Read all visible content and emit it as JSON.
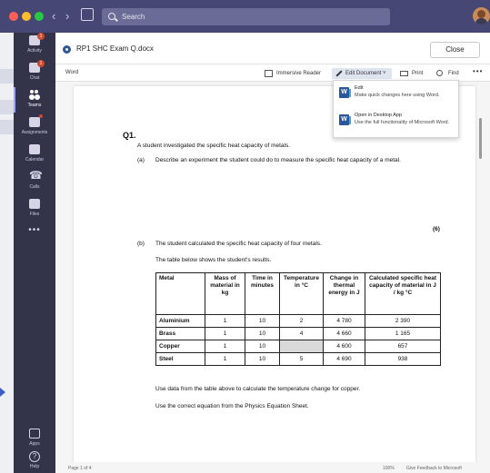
{
  "titlebar": {
    "search_placeholder": "Search",
    "back_icon": "chevron-left-icon",
    "forward_icon": "chevron-right-icon",
    "compose_icon": "compose-icon"
  },
  "rail": {
    "items": [
      {
        "label": "Activity",
        "badge": "1"
      },
      {
        "label": "Chat",
        "badge": "1"
      },
      {
        "label": "Teams"
      },
      {
        "label": "Assignments"
      },
      {
        "label": "Calendar"
      },
      {
        "label": "Calls"
      },
      {
        "label": "Files"
      }
    ],
    "more": "•••",
    "apps_label": "Apps",
    "help_label": "Help",
    "accent": "#9ea2ff"
  },
  "file": {
    "name": "RP1 SHC Exam Q.docx",
    "close_label": "Close"
  },
  "ribbon": {
    "app_label": "Word",
    "immersive_reader": "Immersive Reader",
    "edit_document": "Edit Document ˅",
    "print": "Print",
    "find": "Find",
    "more": "•••"
  },
  "dropdown": {
    "items": [
      {
        "icon": "W",
        "title": "Edit",
        "description": "Make quick changes here using Word."
      },
      {
        "icon": "W",
        "title": "Open in Desktop App",
        "description": "Use the full functionality of Microsoft Word."
      }
    ]
  },
  "document": {
    "question_number": "Q1.",
    "intro": "A student investigated the specific heat capacity of metals.",
    "part_a_label": "(a)",
    "part_a_text": "Describe an experiment the student could do to measure the specific heat capacity of a metal.",
    "part_a_marks": "(6)",
    "part_b_label": "(b)",
    "part_b_text": "The student calculated the specific heat capacity of four metals.",
    "part_b_sub": "The table below shows the student's results.",
    "table": {
      "headers": [
        "Metal",
        "Mass of material in kg",
        "Time in minutes",
        "Temperature in °C",
        "Change in thermal energy in J",
        "Calculated specific heat capacity of material in J / kg °C"
      ],
      "rows": [
        [
          "Aluminium",
          "1",
          "10",
          "2",
          "4 780",
          "2 390"
        ],
        [
          "Brass",
          "1",
          "10",
          "4",
          "4 660",
          "1 165"
        ],
        [
          "Copper",
          "1",
          "10",
          "",
          "4 600",
          "657"
        ],
        [
          "Steel",
          "1",
          "10",
          "5",
          "4 690",
          "938"
        ]
      ]
    },
    "after_table_1": "Use data from the table above to calculate the temperature change for copper.",
    "after_table_2": "Use the correct equation from the Physics Equation Sheet."
  },
  "status": {
    "page": "Page 1 of 4",
    "zoom": "100%",
    "feedback": "Give Feedback to Microsoft"
  }
}
